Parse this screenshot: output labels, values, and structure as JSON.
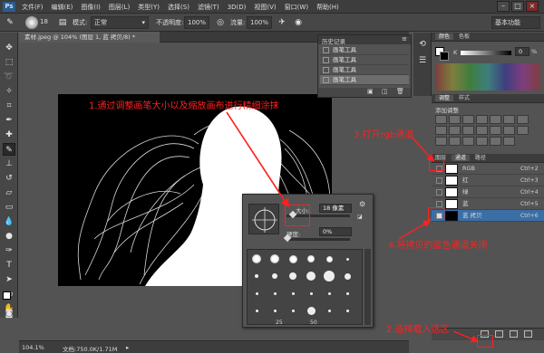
{
  "menu": {
    "logo": "Ps",
    "items": [
      "文件(F)",
      "编辑(E)",
      "图像(I)",
      "图层(L)",
      "类型(Y)",
      "选择(S)",
      "滤镜(T)",
      "3D(D)",
      "视图(V)",
      "窗口(W)",
      "帮助(H)"
    ]
  },
  "options": {
    "brush_size": "18",
    "mode_label": "模式:",
    "mode_value": "正常",
    "opacity_label": "不透明度:",
    "opacity_value": "100%",
    "flow_label": "流量:",
    "flow_value": "100%",
    "workspace": "基本功能"
  },
  "document": {
    "tab_title": "素材.jpeg @ 104% (图层 1, 蓝 拷贝/8) *",
    "zoom": "104.1%",
    "doc_info": "文档:750.0K/1.71M"
  },
  "history": {
    "title": "历史记录",
    "items": [
      "画笔工具",
      "画笔工具",
      "画笔工具",
      "画笔工具"
    ]
  },
  "right_panels": {
    "color_tabs": [
      "颜色",
      "色板"
    ],
    "k_label": "K",
    "k_value": "0",
    "k_unit": "%",
    "adjust_tabs": [
      "调整",
      "样式"
    ],
    "adjust_title": "添加调整",
    "channels_tabs": [
      "图层",
      "通道",
      "路径"
    ],
    "channels": [
      {
        "name": "RGB",
        "shortcut": "Ctrl+2"
      },
      {
        "name": "红",
        "shortcut": "Ctrl+3"
      },
      {
        "name": "绿",
        "shortcut": "Ctrl+4"
      },
      {
        "name": "蓝",
        "shortcut": "Ctrl+5"
      },
      {
        "name": "蓝 拷贝",
        "shortcut": "Ctrl+6"
      }
    ]
  },
  "brush_popup": {
    "size_label": "大小:",
    "size_value": "18 像素",
    "hardness_label": "硬度:",
    "hardness_value": "0%",
    "preset_numbers": [
      "25",
      "50"
    ]
  },
  "annotations": {
    "step1": "1.通过调整画笔大小以及缩放画布进行精细涂抹",
    "step2": "2.选择载入选区",
    "step3": "3.打开rgb通道",
    "step4": "4.将拷贝的蓝色通道关闭"
  },
  "colors": {
    "annotation": "#ff2020",
    "panel_bg": "#535353",
    "selection": "#3b6ea5"
  }
}
